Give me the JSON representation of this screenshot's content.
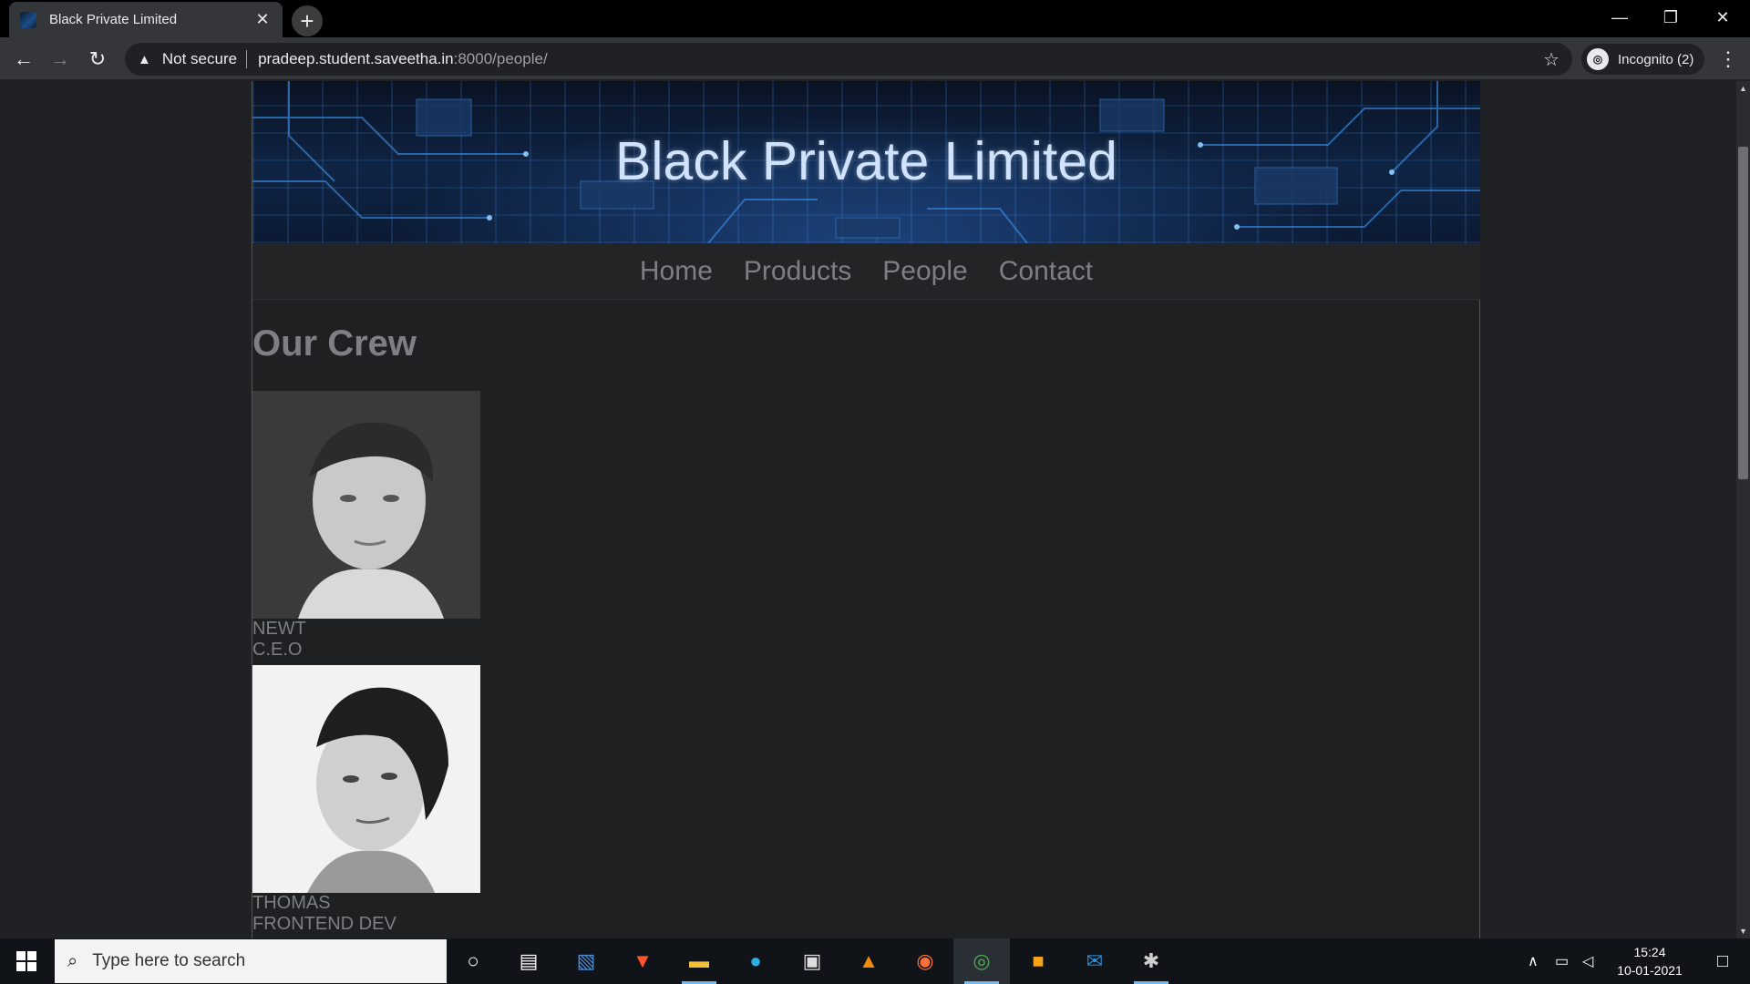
{
  "browser": {
    "tab_title": "Black Private Limited",
    "tab_close": "✕",
    "new_tab": "+",
    "security_label": "Not secure",
    "url_host": "pradeep.student.saveetha.in",
    "url_path": ":8000/people/",
    "profile_label": "Incognito (2)"
  },
  "site": {
    "banner_title": "Black Private Limited",
    "nav": [
      "Home",
      "Products",
      "People",
      "Contact"
    ],
    "section_heading": "Our Crew",
    "members": [
      {
        "name": "NEWT",
        "role": "C.E.O"
      },
      {
        "name": "THOMAS",
        "role": "FRONTEND DEV"
      }
    ]
  },
  "taskbar": {
    "search_placeholder": "Type here to search",
    "time": "15:24",
    "date": "10-01-2021"
  }
}
